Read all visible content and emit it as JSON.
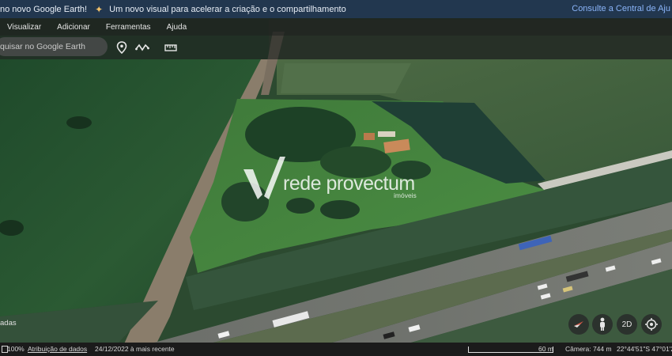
{
  "banner": {
    "text_left": "no novo Google Earth!",
    "text_main": "Um novo visual para acelerar a criação e o compartilhamento",
    "link": "Consulte a Central de Aju"
  },
  "menu": {
    "items": [
      "Visualizar",
      "Adicionar",
      "Ferramentas",
      "Ajuda"
    ]
  },
  "search": {
    "placeholder": "quisar no Google Earth"
  },
  "toolbar": {
    "icons": [
      "placemark-icon",
      "path-icon",
      "ruler-icon"
    ]
  },
  "watermark": {
    "brand_part1": "rede",
    "brand_part2": "provectum",
    "subtitle": "imóveis"
  },
  "map": {
    "left_label": "adas"
  },
  "nav": {
    "view_mode": "2D"
  },
  "status": {
    "zoom": "100%",
    "attribution": "Atribuição de dados",
    "date": "24/12/2022 à mais recente",
    "scale": "60 m",
    "camera": "Câmera: 744 m",
    "coords": "22°44'51\"S 47°01'2"
  },
  "colors": {
    "banner_bg": "#22374f",
    "link": "#8ab4f8",
    "accent_orange": "#f3c26a"
  }
}
